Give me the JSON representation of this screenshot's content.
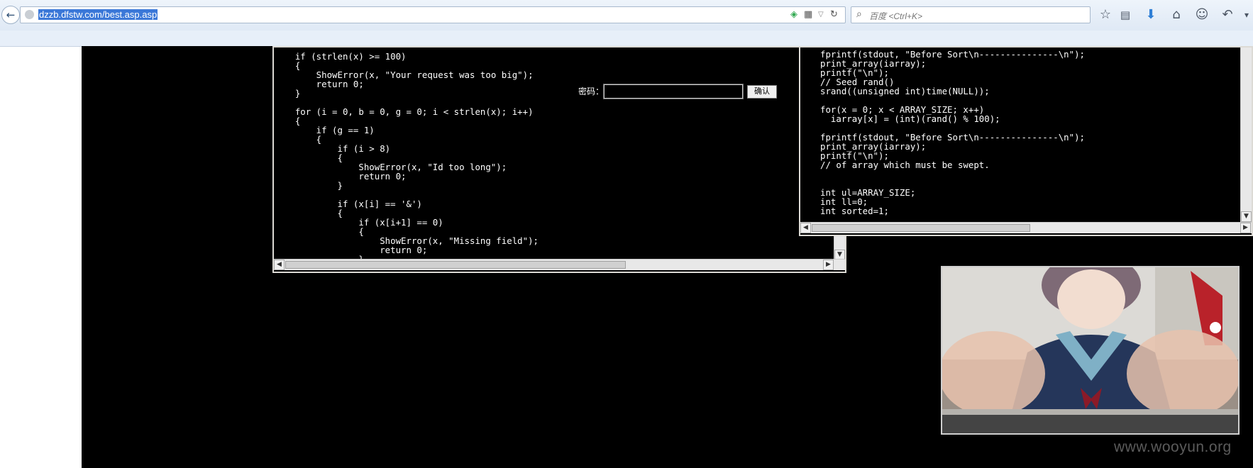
{
  "browser": {
    "url": "dzzb.dfstw.com/best.asp.asp",
    "search_placeholder": "百度 <Ctrl+K>",
    "icons": [
      "back-icon",
      "site-identity-icon",
      "shield-icon",
      "qr-code-icon",
      "dropdown-icon",
      "reload-icon",
      "search-icon",
      "bookmark-star-icon",
      "reading-list-icon",
      "download-icon",
      "home-icon",
      "chat-icon",
      "undo-icon"
    ]
  },
  "login": {
    "password_label": "密码：",
    "password_value": "",
    "confirm_label": "确认"
  },
  "left_code": {
    "lines": [
      "    if (strlen(x) >= 100)",
      "    {",
      "        ShowError(x, \"Your request was too big\");",
      "        return 0;",
      "    }",
      "",
      "    for (i = 0, b = 0, g = 0; i < strlen(x); i++)",
      "    {",
      "        if (g == 1)",
      "        {",
      "            if (i > 8)",
      "            {",
      "                ShowError(x, \"Id too long\");",
      "                return 0;",
      "            }",
      "",
      "            if (x[i] == '&')",
      "            {",
      "                if (x[i+1] == 0)",
      "                {",
      "                    ShowError(x, \"Missing field\");",
      "                    return 0;",
      "                }"
    ]
  },
  "right_code": {
    "lines": [
      "fprintf(stdout, \"Before Sort\\n---------------\\n\");",
      "print_array(iarray);",
      "printf(\"\\n\");",
      "// Seed rand()",
      "srand((unsigned int)time(NULL));",
      "",
      "for(x = 0; x < ARRAY_SIZE; x++)",
      "  iarray[x] = (int)(rand() % 100);",
      "",
      "fprintf(stdout, \"Before Sort\\n---------------\\n\");",
      "print_array(iarray);",
      "printf(\"\\n\");",
      "// of array which must be swept.",
      "",
      "",
      "int ul=ARRAY_SIZE;",
      "int ll=0;",
      "int sorted=1;"
    ]
  },
  "watermark": "www.wooyun.org"
}
